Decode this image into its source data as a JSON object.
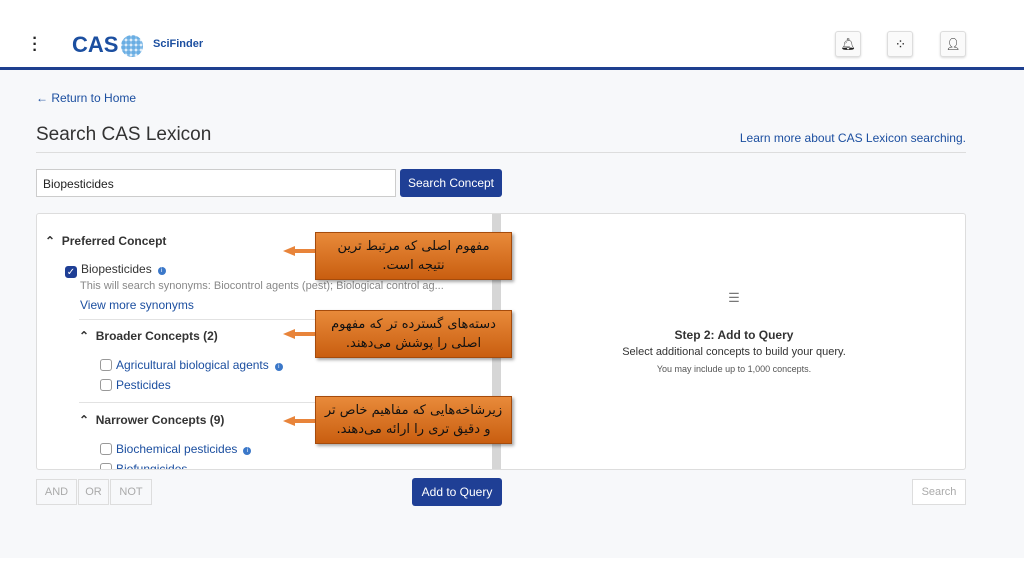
{
  "header": {
    "brand": "CAS",
    "product": "SciFinder",
    "icons": [
      "kebab-menu-icon",
      "bell-icon",
      "apps-grid-icon",
      "user-icon"
    ]
  },
  "nav": {
    "back": "← Return to Home"
  },
  "page": {
    "title": "Search CAS Lexicon",
    "learn_more": "Learn more about CAS Lexicon searching."
  },
  "search": {
    "value": "Biopesticides",
    "button": "Search Concept"
  },
  "concepts": {
    "preferred_header": "Preferred Concept",
    "preferred": {
      "label": "Biopesticides",
      "checked": true,
      "synonyms": "This will search synonyms: Biocontrol agents (pest); Biological control ag...",
      "more": "View more synonyms"
    },
    "broader_header": "Broader Concepts (2)",
    "broader": [
      {
        "label": "Agricultural biological agents"
      },
      {
        "label": "Pesticides"
      }
    ],
    "narrower_header": "Narrower Concepts (9)",
    "narrower": [
      {
        "label": "Biochemical pesticides"
      },
      {
        "label": "Biofungicides"
      }
    ]
  },
  "step2": {
    "title": "Step 2: Add to Query",
    "subtitle": "Select additional concepts to build your query.",
    "note": "You may include up to 1,000 concepts."
  },
  "footer": {
    "and": "AND",
    "or": "OR",
    "not": "NOT",
    "add": "Add to Query",
    "search": "Search"
  },
  "callouts": [
    "مفهوم اصلی که مرتبط ترین نتیجه است.",
    "دسته‌های گسترده تر که مفهوم اصلی را پوشش می‌دهند.",
    "زیرشاخه‌هایی که مفاهیم خاص تر و دقیق تری را ارائه می‌دهند."
  ],
  "colors": {
    "primary": "#1f3f95",
    "link": "#1c4fa0",
    "callout": "#e07a2a"
  }
}
